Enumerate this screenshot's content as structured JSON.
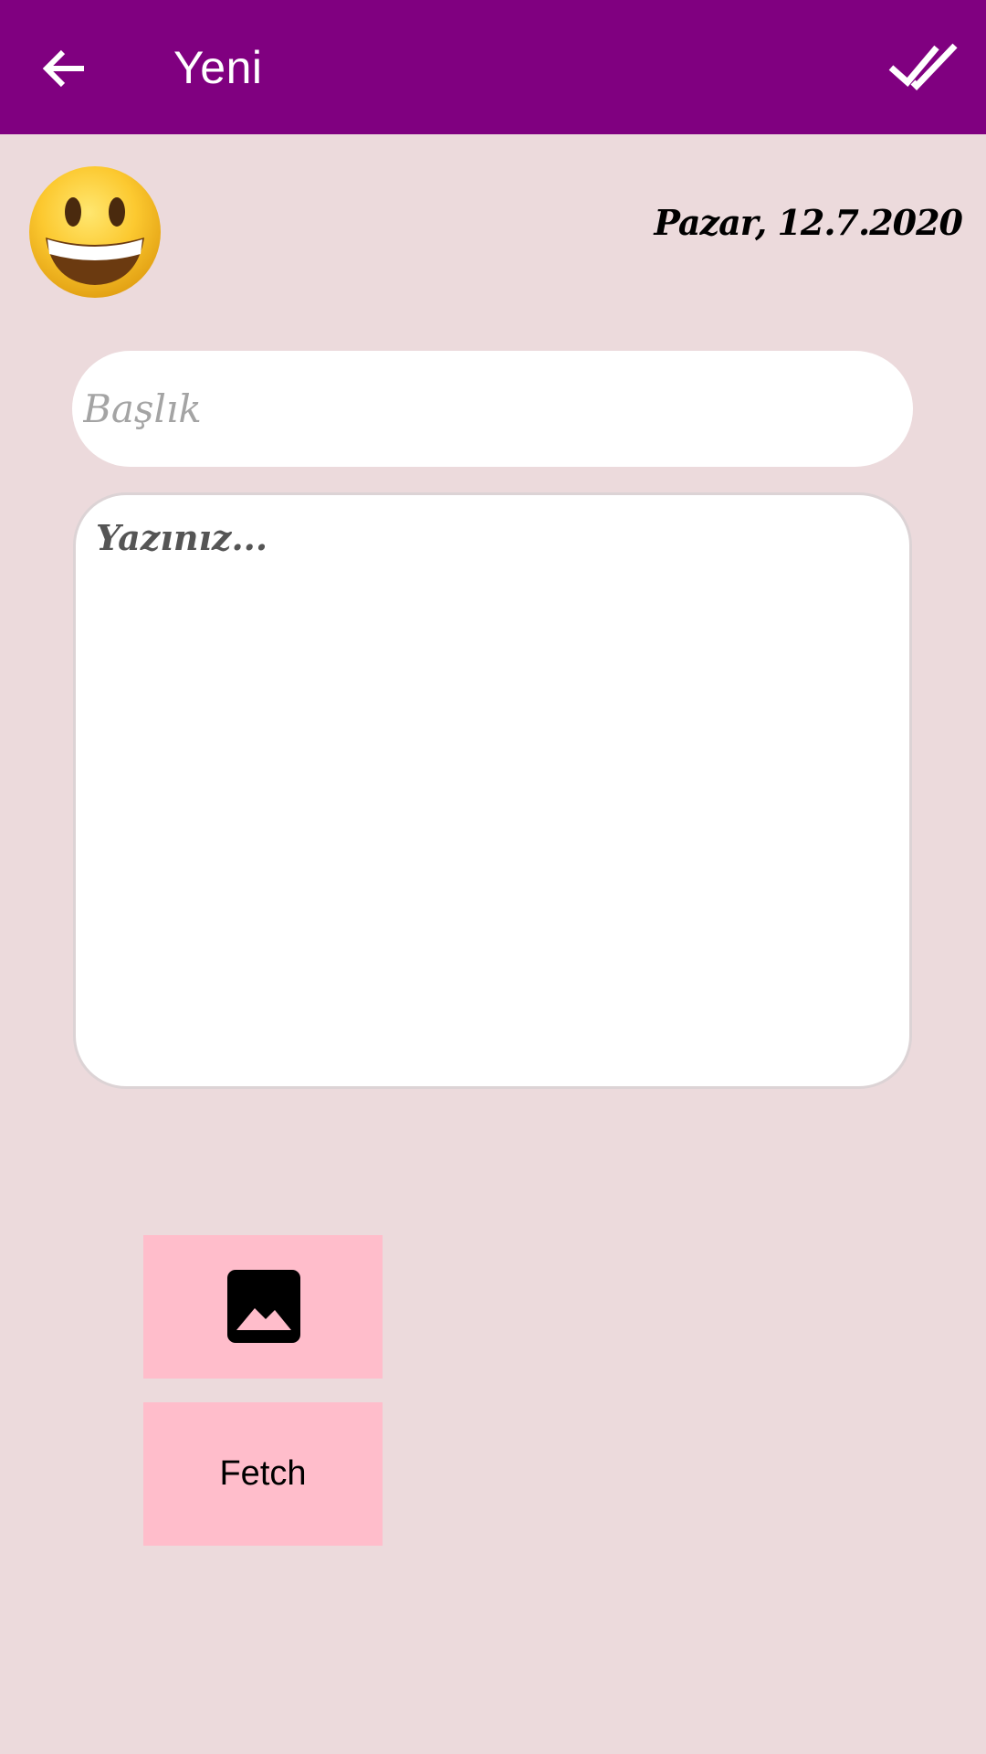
{
  "appbar": {
    "back_icon": "arrow-back-icon",
    "title": "Yeni",
    "done_icon": "double-check-icon",
    "background": "#800080"
  },
  "entry": {
    "mood_icon": "grinning-face-emoji",
    "date": "Pazar, 12.7.2020",
    "title_placeholder": "Başlık",
    "title_value": "",
    "body_placeholder": "Yazınız...",
    "body_value": ""
  },
  "actions": {
    "image_icon": "image-icon",
    "fetch_label": "Fetch",
    "button_color": "#ffbdcb"
  },
  "colors": {
    "page_background": "#ecdadc",
    "accent": "#800080"
  }
}
